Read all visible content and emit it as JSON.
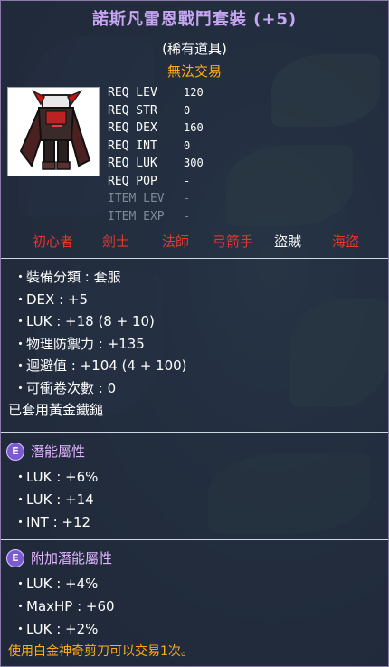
{
  "item": {
    "name": "諾斯凡雷恩戰鬥套裝 (+5)",
    "rarity": "(稀有道具)",
    "trade_status": "無法交易"
  },
  "requirements": [
    {
      "label": "REQ LEV",
      "value": "120",
      "dim": false
    },
    {
      "label": "REQ STR",
      "value": "0",
      "dim": false
    },
    {
      "label": "REQ DEX",
      "value": "160",
      "dim": false
    },
    {
      "label": "REQ INT",
      "value": "0",
      "dim": false
    },
    {
      "label": "REQ LUK",
      "value": "300",
      "dim": false
    },
    {
      "label": "REQ POP",
      "value": "-",
      "dim": false
    },
    {
      "label": "ITEM LEV",
      "value": "-",
      "dim": true
    },
    {
      "label": "ITEM EXP",
      "value": "-",
      "dim": true
    }
  ],
  "jobs": [
    {
      "name": "初心者",
      "color": "#e0392e"
    },
    {
      "name": "劍士",
      "color": "#e0392e"
    },
    {
      "name": "法師",
      "color": "#e0392e"
    },
    {
      "name": "弓箭手",
      "color": "#e0392e"
    },
    {
      "name": "盜賊",
      "color": "#ffffff"
    },
    {
      "name": "海盜",
      "color": "#e0392e"
    }
  ],
  "stats": [
    "裝備分類 : 套服",
    "DEX : +5",
    "LUK : +18 (8 + 10)",
    "物理防禦力 : +135",
    "迴避值 : +104 (4 + 100)",
    "可衝卷次數 : 0"
  ],
  "stat_bullet": "・",
  "protection_note": "已套用黃金鐵鎚",
  "potential": {
    "badge": "E",
    "title": "潛能屬性",
    "lines": [
      "LUK : +6%",
      "LUK : +14",
      "INT : +12"
    ]
  },
  "bonus_potential": {
    "badge": "E",
    "title": "附加潛能屬性",
    "lines": [
      "LUK : +4%",
      "MaxHP : +60",
      "LUK : +2%"
    ]
  },
  "footer_note": "使用白金神奇剪刀可以交易1次。",
  "colors": {
    "title": "#c6a6f2",
    "accent_orange": "#ffad18",
    "job_disabled": "#e0392e",
    "job_enabled": "#ffffff",
    "section_title": "#e2b6ff"
  },
  "icons": {
    "item": "rain-battle-overall-icon",
    "section_badge": "epic-grade-badge-icon"
  }
}
